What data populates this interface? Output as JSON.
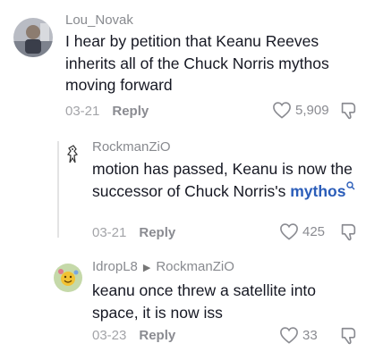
{
  "comments": [
    {
      "username": "Lou_Novak",
      "text": "I hear by petition that Keanu Reeves inherits all of the Chuck Norris mythos moving forward",
      "date": "03-21",
      "reply_label": "Reply",
      "likes": "5,909"
    },
    {
      "username": "RockmanZiO",
      "text": "motion has passed, Keanu is now the successor of Chuck Norris's",
      "link_text": "mythos",
      "date": "03-21",
      "reply_label": "Reply",
      "likes": "425"
    },
    {
      "username": "IdropL8",
      "reply_to": "RockmanZiO",
      "text": "keanu once threw a satellite into space, it is now iss",
      "date": "03-23",
      "reply_label": "Reply",
      "likes": "33"
    }
  ],
  "colors": {
    "text": "#161823",
    "username": "#888a8f",
    "meta": "#a3a4a8",
    "link": "#2b5db9"
  }
}
